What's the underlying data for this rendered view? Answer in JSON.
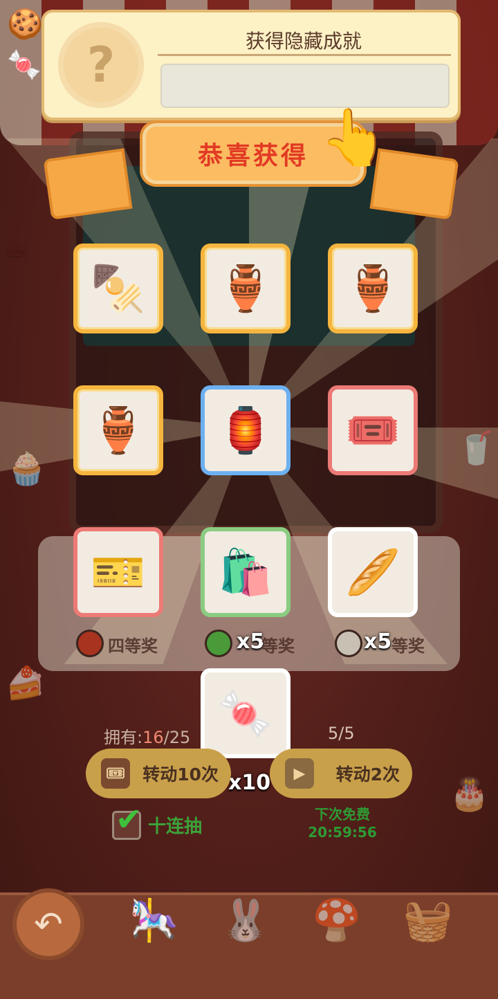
{
  "achievement": {
    "title": "获得隐藏成就",
    "badge_glyph": "?",
    "description": ""
  },
  "banner": {
    "title": "恭喜获得"
  },
  "rewards": [
    {
      "name": "bbq-stall-decor",
      "icon": "🍢",
      "quantity": "",
      "border": "gold"
    },
    {
      "name": "golden-teapot",
      "icon": "🏺",
      "quantity": "",
      "border": "gold"
    },
    {
      "name": "golden-teapot",
      "icon": "🏺",
      "quantity": "",
      "border": "gold"
    },
    {
      "name": "golden-teapot",
      "icon": "🏺",
      "quantity": "",
      "border": "gold"
    },
    {
      "name": "hanging-lantern",
      "icon": "🏮",
      "quantity": "",
      "border": "blue"
    },
    {
      "name": "red-ticket",
      "icon": "🎟️",
      "quantity": "",
      "border": "red"
    },
    {
      "name": "pink-ticket",
      "icon": "🎫",
      "quantity": "",
      "border": "red"
    },
    {
      "name": "paper-bags",
      "icon": "🛍️",
      "quantity": "x5",
      "border": "green"
    },
    {
      "name": "sleep-bread",
      "icon": "🥖",
      "quantity": "x5",
      "border": "white"
    },
    {
      "name": "purple-candy",
      "icon": "🍬",
      "quantity": "x10",
      "border": "white"
    }
  ],
  "prize_labels": {
    "fourth": "四等奖",
    "second_partial": "等奖",
    "third_partial": "等奖"
  },
  "ownership": {
    "label": "拥有:",
    "current": "16",
    "total_partial": "/25"
  },
  "spins_left": "5/5",
  "buttons": {
    "spin10": "转动10次",
    "spin2": "转动2次"
  },
  "ten_draw_label": "十连抽",
  "ten_draw_checked": true,
  "next_free": {
    "label": "下次免费",
    "timer": "20:59:56"
  },
  "colors": {
    "gold_border": "#f5b53e",
    "blue_border": "#6db0f2",
    "red_border": "#ec7a76",
    "green_border": "#8acc82",
    "ribbon_text": "#e23a24",
    "free_text": "#2e9b34"
  }
}
